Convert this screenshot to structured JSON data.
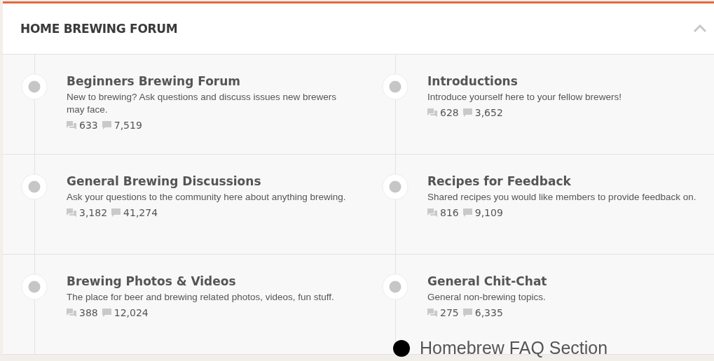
{
  "section": {
    "title": "HOME BREWING FORUM",
    "expanded": true
  },
  "forums": [
    {
      "title": "Beginners Brewing Forum",
      "description": "New to brewing? Ask questions and discuss issues new brewers may face.",
      "threads": "633",
      "messages": "7,519"
    },
    {
      "title": "Introductions",
      "description": "Introduce yourself here to your fellow brewers!",
      "threads": "628",
      "messages": "3,652"
    },
    {
      "title": "General Brewing Discussions",
      "description": "Ask your questions to the community here about anything brewing.",
      "threads": "3,182",
      "messages": "41,274"
    },
    {
      "title": "Recipes for Feedback",
      "description": "Shared recipes you would like members to provide feedback on.",
      "threads": "816",
      "messages": "9,109"
    },
    {
      "title": "Brewing Photos & Videos",
      "description": "The place for beer and brewing related photos, videos, fun stuff.",
      "threads": "388",
      "messages": "12,024"
    },
    {
      "title": "General Chit-Chat",
      "description": "General non-brewing topics.",
      "threads": "275",
      "messages": "6,335"
    }
  ],
  "overlay_item": {
    "label": "Homebrew FAQ Section"
  }
}
